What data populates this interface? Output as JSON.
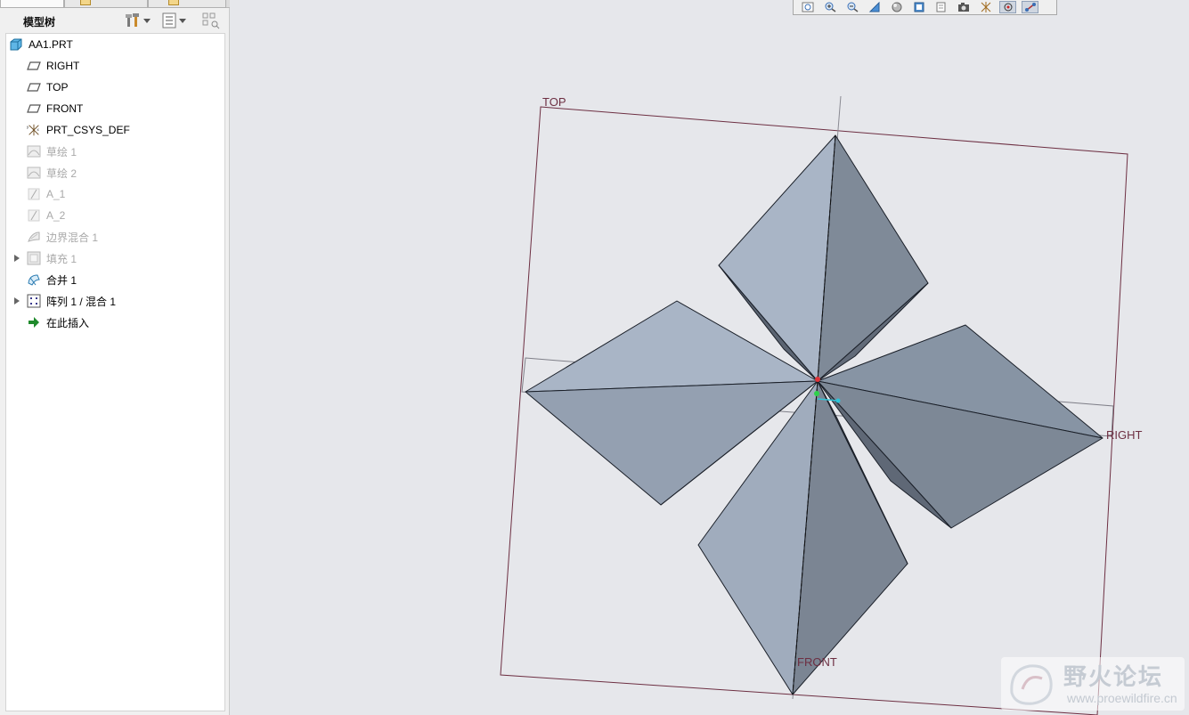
{
  "model_tree": {
    "title": "模型树",
    "items": [
      {
        "label": "AA1.PRT",
        "icon": "part-icon",
        "dim": false,
        "expandable": false
      },
      {
        "label": "RIGHT",
        "icon": "datum-plane-icon",
        "dim": false,
        "expandable": false
      },
      {
        "label": "TOP",
        "icon": "datum-plane-icon",
        "dim": false,
        "expandable": false
      },
      {
        "label": "FRONT",
        "icon": "datum-plane-icon",
        "dim": false,
        "expandable": false
      },
      {
        "label": "PRT_CSYS_DEF",
        "icon": "csys-icon",
        "dim": false,
        "expandable": false
      },
      {
        "label": "草绘 1",
        "icon": "sketch-icon",
        "dim": true,
        "expandable": false
      },
      {
        "label": "草绘 2",
        "icon": "sketch-icon",
        "dim": true,
        "expandable": false
      },
      {
        "label": "A_1",
        "icon": "datum-axis-icon",
        "dim": true,
        "expandable": false
      },
      {
        "label": "A_2",
        "icon": "datum-axis-icon",
        "dim": true,
        "expandable": false
      },
      {
        "label": "边界混合 1",
        "icon": "boundary-blend-icon",
        "dim": true,
        "expandable": false
      },
      {
        "label": "填充 1",
        "icon": "fill-icon",
        "dim": true,
        "expandable": true
      },
      {
        "label": "合并 1",
        "icon": "merge-icon",
        "dim": false,
        "expandable": false
      },
      {
        "label": "阵列 1 / 混合 1",
        "icon": "pattern-icon",
        "dim": false,
        "expandable": true
      },
      {
        "label": "在此插入",
        "icon": "insert-here-icon",
        "dim": false,
        "expandable": false
      }
    ]
  },
  "viewport": {
    "datum_labels": {
      "top": "TOP",
      "right": "RIGHT",
      "front": "FRONT"
    },
    "toolbar_icons": [
      "refit-icon",
      "zoom-in-icon",
      "zoom-out-icon",
      "repaint-icon",
      "shading-icon",
      "saved-views-icon",
      "layers-icon",
      "camera-icon",
      "datum-display-icon",
      "spin-center-icon",
      "annotation-icon"
    ]
  },
  "watermark": {
    "name": "野火论坛",
    "url": "www.proewildfire.cn"
  },
  "colors": {
    "face_light": "#a9b5c6",
    "face_dark": "#7f8a98",
    "datum": "#6d2f42"
  }
}
